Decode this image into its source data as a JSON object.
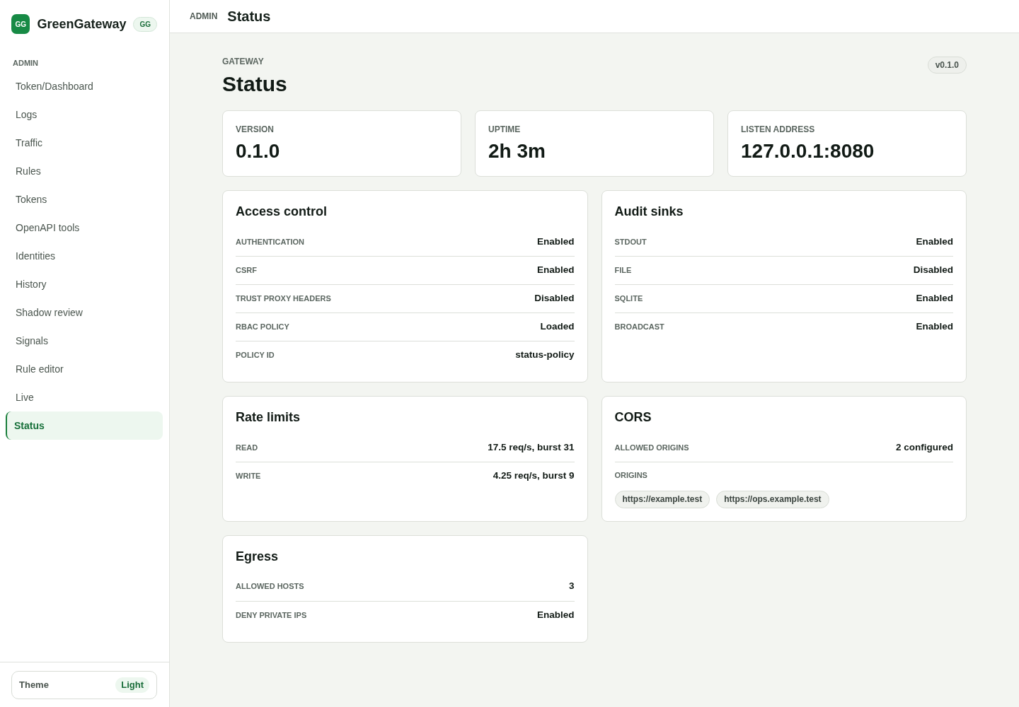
{
  "sidebar": {
    "brand": {
      "logo": "GG",
      "name": "GreenGateway",
      "badge": "GG"
    },
    "section": "ADMIN",
    "items": [
      {
        "label": "Token/Dashboard",
        "selected": false
      },
      {
        "label": "Logs",
        "selected": false
      },
      {
        "label": "Traffic",
        "selected": false
      },
      {
        "label": "Rules",
        "selected": false
      },
      {
        "label": "Tokens",
        "selected": false
      },
      {
        "label": "OpenAPI tools",
        "selected": false
      },
      {
        "label": "Identities",
        "selected": false
      },
      {
        "label": "History",
        "selected": false
      },
      {
        "label": "Shadow review",
        "selected": false
      },
      {
        "label": "Signals",
        "selected": false
      },
      {
        "label": "Rule editor",
        "selected": false
      },
      {
        "label": "Live",
        "selected": false
      },
      {
        "label": "Status",
        "selected": true
      }
    ],
    "theme": {
      "label": "Theme",
      "value": "Light"
    }
  },
  "topbar": {
    "section": "ADMIN",
    "title": "Status"
  },
  "header": {
    "eyebrow": "GATEWAY",
    "title": "Status",
    "badge": "v0.1.0"
  },
  "stats": [
    {
      "label": "VERSION",
      "value": "0.1.0"
    },
    {
      "label": "UPTIME",
      "value": "2h 3m"
    },
    {
      "label": "LISTEN ADDRESS",
      "value": "127.0.0.1:8080"
    }
  ],
  "panels": [
    {
      "title": "Access control",
      "rows": [
        {
          "label": "AUTHENTICATION",
          "value": "Enabled"
        },
        {
          "label": "CSRF",
          "value": "Enabled"
        },
        {
          "label": "TRUST PROXY HEADERS",
          "value": "Disabled"
        },
        {
          "label": "RBAC POLICY",
          "value": "Loaded"
        },
        {
          "label": "POLICY ID",
          "value": "status-policy"
        }
      ]
    },
    {
      "title": "Audit sinks",
      "rows": [
        {
          "label": "STDOUT",
          "value": "Enabled"
        },
        {
          "label": "FILE",
          "value": "Disabled"
        },
        {
          "label": "SQLITE",
          "value": "Enabled"
        },
        {
          "label": "BROADCAST",
          "value": "Enabled"
        }
      ]
    },
    {
      "title": "Rate limits",
      "rows": [
        {
          "label": "READ",
          "value": "17.5 req/s, burst 31"
        },
        {
          "label": "WRITE",
          "value": "4.25 req/s, burst 9"
        }
      ]
    },
    {
      "title": "CORS",
      "rows": [
        {
          "label": "ALLOWED ORIGINS",
          "value": "2 configured"
        }
      ],
      "origins": {
        "label": "ORIGINS",
        "chips": [
          "https://example.test",
          "https://ops.example.test"
        ]
      }
    },
    {
      "title": "Egress",
      "rows": [
        {
          "label": "ALLOWED HOSTS",
          "value": "3"
        },
        {
          "label": "DENY PRIVATE IPS",
          "value": "Enabled"
        }
      ]
    }
  ]
}
